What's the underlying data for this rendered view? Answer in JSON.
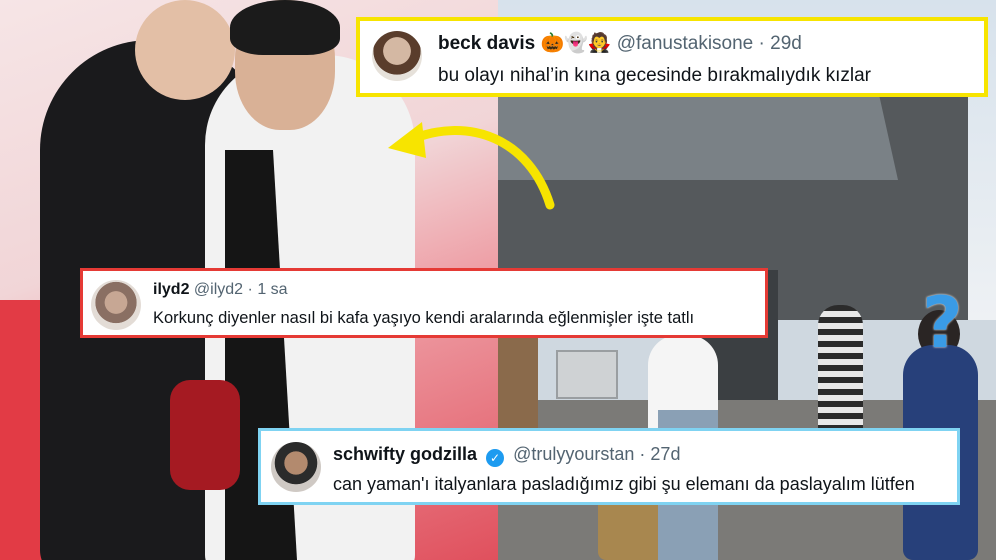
{
  "tweets": [
    {
      "name": "beck davis",
      "emojis": "🎃👻🧛",
      "handle": "@fanustakisone",
      "separator": "·",
      "time": "29d",
      "text": "bu olayı nihal’in kına gecesinde bırakmalıydık kızlar",
      "border_color": "#f7e400"
    },
    {
      "name": "ilyd2",
      "handle": "@ilyd2",
      "separator": "·",
      "time": "1 sa",
      "text": "Korkunç diyenler nasıl bi kafa yaşıyo kendi aralarında eğlenmişler işte tatlı",
      "border_color": "#e53a35"
    },
    {
      "name": "schwifty godzilla",
      "verified_glyph": "✓",
      "handle": "@trulyyourstan",
      "separator": "·",
      "time": "27d",
      "text": "can yaman'ı italyanlara pasladığımız gibi şu elemanı da paslayalım lütfen",
      "border_color": "#7fd3f2"
    }
  ],
  "overlay": {
    "question_mark": "?",
    "arrow_color": "#f7e400",
    "question_color": "#3a9be6"
  }
}
